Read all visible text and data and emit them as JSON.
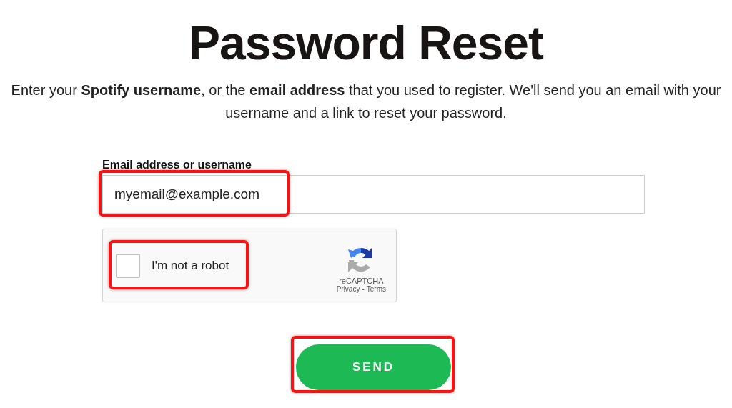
{
  "title": "Password Reset",
  "intro": "Enter your **Spotify username**, or the **email address** that you used to register. We'll send you an email with your username and a link to reset your password.",
  "email_field": {
    "label": "Email address or username",
    "value": "myemail@example.com",
    "highlighted": true
  },
  "captcha": {
    "label": "I'm not a robot",
    "checked": false,
    "highlighted": true,
    "brand": "reCAPTCHA",
    "links": [
      "Privacy",
      "Terms"
    ],
    "separator": "-"
  },
  "send_button": {
    "label": "SEND",
    "highlighted": true
  }
}
